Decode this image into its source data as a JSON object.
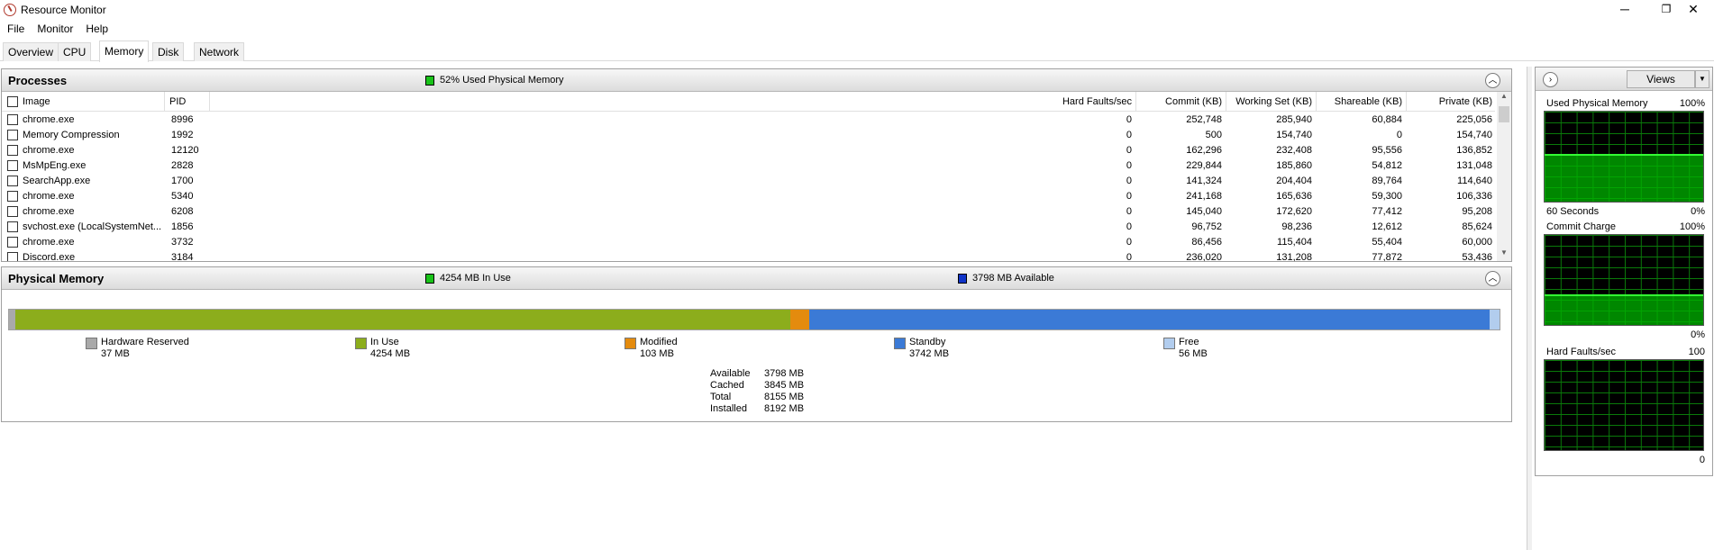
{
  "window": {
    "title": "Resource Monitor",
    "minimize": "─",
    "restore": "❐",
    "close": "✕"
  },
  "menu": [
    "File",
    "Monitor",
    "Help"
  ],
  "tabs": [
    "Overview",
    "CPU",
    "Memory",
    "Disk",
    "Network"
  ],
  "processes": {
    "title": "Processes",
    "legend": "52% Used Physical Memory",
    "legend_color": "#19c319",
    "columns": {
      "image": "Image",
      "pid": "PID",
      "hard_faults": "Hard Faults/sec",
      "commit": "Commit (KB)",
      "working_set": "Working Set (KB)",
      "shareable": "Shareable (KB)",
      "private": "Private (KB)"
    },
    "rows": [
      {
        "image": "chrome.exe",
        "pid": "8996",
        "hard_faults": "0",
        "commit": "252,748",
        "working_set": "285,940",
        "shareable": "60,884",
        "private": "225,056"
      },
      {
        "image": "Memory Compression",
        "pid": "1992",
        "hard_faults": "0",
        "commit": "500",
        "working_set": "154,740",
        "shareable": "0",
        "private": "154,740"
      },
      {
        "image": "chrome.exe",
        "pid": "12120",
        "hard_faults": "0",
        "commit": "162,296",
        "working_set": "232,408",
        "shareable": "95,556",
        "private": "136,852"
      },
      {
        "image": "MsMpEng.exe",
        "pid": "2828",
        "hard_faults": "0",
        "commit": "229,844",
        "working_set": "185,860",
        "shareable": "54,812",
        "private": "131,048"
      },
      {
        "image": "SearchApp.exe",
        "pid": "1700",
        "hard_faults": "0",
        "commit": "141,324",
        "working_set": "204,404",
        "shareable": "89,764",
        "private": "114,640"
      },
      {
        "image": "chrome.exe",
        "pid": "5340",
        "hard_faults": "0",
        "commit": "241,168",
        "working_set": "165,636",
        "shareable": "59,300",
        "private": "106,336"
      },
      {
        "image": "chrome.exe",
        "pid": "6208",
        "hard_faults": "0",
        "commit": "145,040",
        "working_set": "172,620",
        "shareable": "77,412",
        "private": "95,208"
      },
      {
        "image": "svchost.exe (LocalSystemNet...",
        "pid": "1856",
        "hard_faults": "0",
        "commit": "96,752",
        "working_set": "98,236",
        "shareable": "12,612",
        "private": "85,624"
      },
      {
        "image": "chrome.exe",
        "pid": "3732",
        "hard_faults": "0",
        "commit": "86,456",
        "working_set": "115,404",
        "shareable": "55,404",
        "private": "60,000"
      },
      {
        "image": "Discord.exe",
        "pid": "3184",
        "hard_faults": "0",
        "commit": "236,020",
        "working_set": "131,208",
        "shareable": "77,872",
        "private": "53,436"
      }
    ]
  },
  "physical_memory": {
    "title": "Physical Memory",
    "legend_in_use": "4254 MB In Use",
    "legend_available": "3798 MB Available",
    "bar": [
      {
        "name": "hardware-reserved",
        "fraction": 0.0045,
        "color": "#a9a9a9"
      },
      {
        "name": "in-use",
        "fraction": 0.52,
        "color": "#8cad1c"
      },
      {
        "name": "modified",
        "fraction": 0.0126,
        "color": "#e48b0e"
      },
      {
        "name": "standby",
        "fraction": 0.4566,
        "color": "#3b7ad6"
      },
      {
        "name": "free",
        "fraction": 0.0069,
        "color": "#b2cdee"
      }
    ],
    "legend": [
      {
        "label": "Hardware Reserved",
        "value": "37 MB",
        "color": "#a9a9a9"
      },
      {
        "label": "In Use",
        "value": "4254 MB",
        "color": "#8cad1c"
      },
      {
        "label": "Modified",
        "value": "103 MB",
        "color": "#e48b0e"
      },
      {
        "label": "Standby",
        "value": "3742 MB",
        "color": "#3b7ad6"
      },
      {
        "label": "Free",
        "value": "56 MB",
        "color": "#b2cdee"
      }
    ],
    "stats": [
      {
        "label": "Available",
        "value": "3798 MB"
      },
      {
        "label": "Cached",
        "value": "3845 MB"
      },
      {
        "label": "Total",
        "value": "8155 MB"
      },
      {
        "label": "Installed",
        "value": "8192 MB"
      }
    ]
  },
  "side": {
    "views": "Views",
    "graphs": [
      {
        "title": "Used Physical Memory",
        "max": "100%",
        "footer_left": "60 Seconds",
        "footer_right": "0%",
        "level": 0.52
      },
      {
        "title": "Commit Charge",
        "max": "100%",
        "footer_left": "",
        "footer_right": "0%",
        "level": 0.33
      },
      {
        "title": "Hard Faults/sec",
        "max": "100",
        "footer_left": "",
        "footer_right": "0",
        "level": 0.0
      }
    ]
  }
}
